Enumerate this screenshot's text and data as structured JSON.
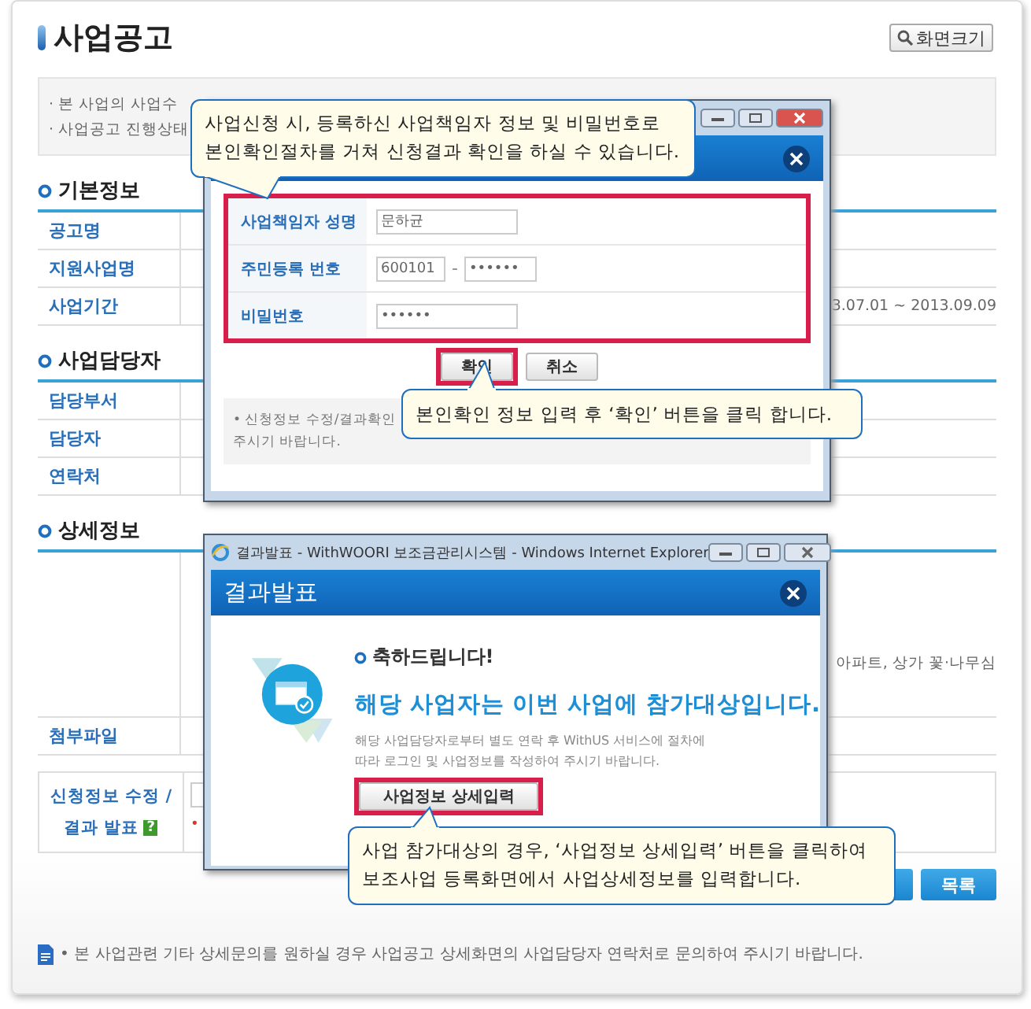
{
  "page": {
    "title": "사업공고",
    "zoom_button": "화면크기",
    "notices": [
      "· 본 사업의 사업수",
      "· 사업공고 진행상태"
    ],
    "sections": [
      {
        "heading": "기본정보",
        "rows": [
          {
            "label": "공고명"
          },
          {
            "label": "지원사업명"
          },
          {
            "label": "사업기간",
            "right": "3.07.01 ~ 2013.09.09"
          }
        ]
      },
      {
        "heading": "사업담당자",
        "rows": [
          {
            "label": "담당부서"
          },
          {
            "label": "담당자"
          },
          {
            "label": "연락처"
          }
        ]
      },
      {
        "heading": "상세정보",
        "rows": [
          {
            "kind": "tall",
            "right": "아파트, 상가 꽃·나무심"
          },
          {
            "kind": "plain",
            "label": "첨부파일"
          }
        ]
      }
    ],
    "apply": {
      "label_lines": [
        "신청정보 수정 /",
        "결과 발표"
      ],
      "help": "?",
      "required_mark": "•"
    },
    "list_button": "목록",
    "footer": "• 본 사업관련 기타 상세문의를 원하실 경우 사업공고 상세화면의 사업담당자 연락처로 문의하여 주시기 바랍니다."
  },
  "login_window": {
    "fields": [
      {
        "label": "사업책임자 성명",
        "kind": "text",
        "values": [
          "문하균"
        ]
      },
      {
        "label": "주민등록 번호",
        "kind": "split",
        "values": [
          "600101",
          "••••••"
        ],
        "separator": "-"
      },
      {
        "label": "비밀번호",
        "kind": "password",
        "values": [
          "••••••"
        ]
      }
    ],
    "buttons": [
      {
        "label": "확인",
        "highlighted": true
      },
      {
        "label": "취소",
        "highlighted": false
      }
    ],
    "note_lines": [
      "• 신청정보 수정/결과확인",
      "주시기 바랍니다."
    ]
  },
  "result_window": {
    "title": "결과발표 - WithWOORI 보조금관리시스템 - Windows Internet Explorer",
    "header": "결과발표",
    "congrats": "축하드립니다!",
    "headline": "해당 사업자는 이번 사업에 참가대상입니다.",
    "info": "해당 사업담당자로부터 별도 연락 후 WithUS 서비스에 절차에\n따라 로그인 및 사업정보를 작성하여 주시기 바랍니다.",
    "button": {
      "label": "사업정보 상세입력",
      "highlighted": true
    }
  },
  "callouts": [
    {
      "text": "사업신청 시, 등록하신 사업책임자 정보 및 비밀번호로\n본인확인절차를 거쳐 신청결과 확인을 하실 수 있습니다."
    },
    {
      "text": "본인확인 정보 입력 후 ‘확인’ 버튼을 클릭 합니다."
    },
    {
      "text": "사업 참가대상의 경우, ‘사업정보 상세입력’ 버튼을 클릭하여\n보조사업 등록화면에서 사업상세정보를 입력합니다."
    }
  ]
}
